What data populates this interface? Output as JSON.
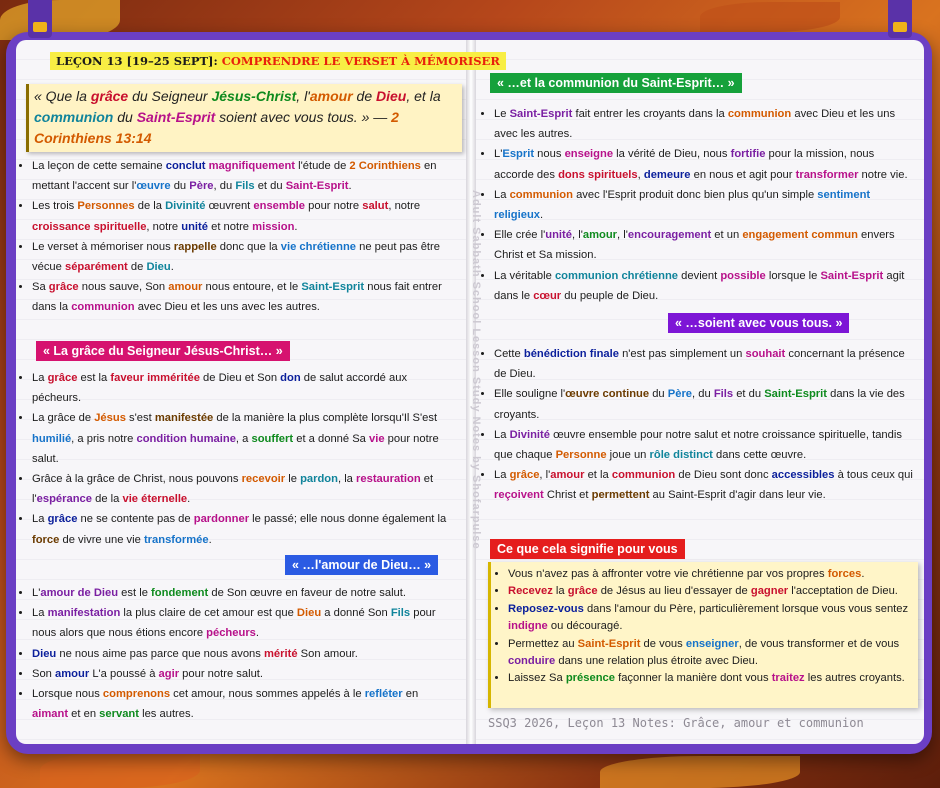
{
  "header": {
    "lesson_label": "LEÇON 13 [19–25 SEPT]:",
    "lesson_topic": "COMPRENDRE LE VERSET À MÉMORISER"
  },
  "memory_verse": {
    "parts": [
      "« Que la ",
      "grâce",
      " du Seigneur ",
      "Jésus-Christ",
      ", l'",
      "amour",
      " de ",
      "Dieu",
      ", et la ",
      "communion",
      " du ",
      "Saint-Esprit",
      " soient avec vous tous. » — ",
      "2 Corinthiens 13:14"
    ]
  },
  "section_titles": {
    "grace": "« La grâce du Seigneur Jésus-Christ… »",
    "love": "« …l'amour de Dieu… »",
    "communion": "« …et la communion du Saint-Esprit… »",
    "with_you": "« …soient avec vous tous. »",
    "meaning": "Ce que cela signifie pour vous"
  },
  "colors": {
    "grace_header": "#d6126f",
    "love_header": "#2b5be3",
    "communion_header": "#16a13b",
    "with_you_header": "#7d16d6",
    "meaning_header": "#e51d1d",
    "cover": "#6b3fc4"
  },
  "watermark": "Adult Sabbath School Lesson Study Notes by Shofarpulse",
  "footer": "SSQ3 2026, Leçon 13 Notes: Grâce, amour et communion",
  "icons": [
    "bookmark-clip-icon"
  ]
}
